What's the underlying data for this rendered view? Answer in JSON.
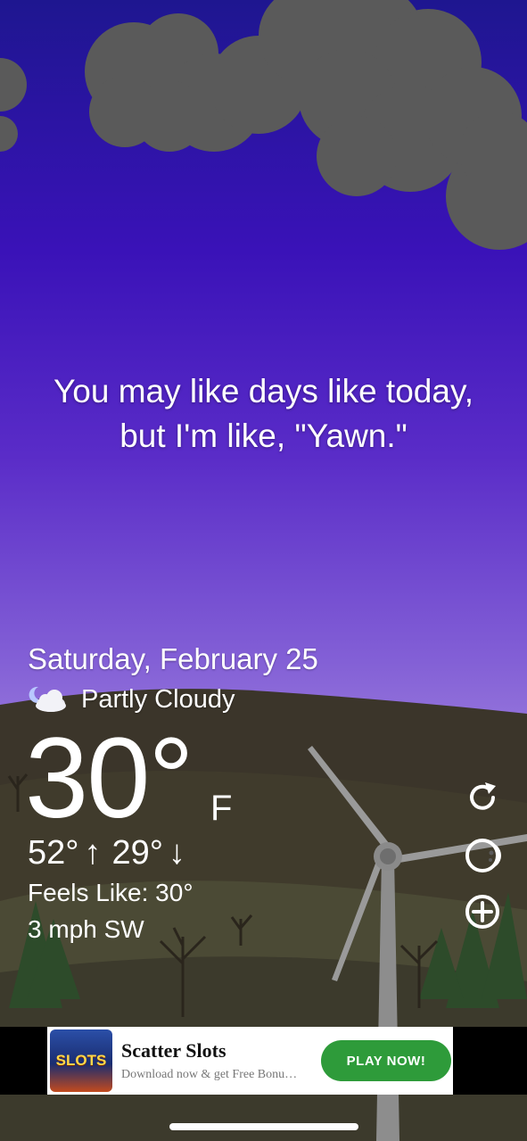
{
  "quote": {
    "line1": "You may like days like today,",
    "line2": "but I'm like, \"Yawn.\""
  },
  "weather": {
    "date": "Saturday, February 25",
    "condition": "Partly Cloudy",
    "condition_icon": "partly-cloudy-night-icon",
    "temperature": "30°",
    "unit": "F",
    "high": "52°",
    "high_arrow": "↑",
    "low": "29°",
    "low_arrow": "↓",
    "feels_like": "Feels Like: 30°",
    "wind": "3 mph SW"
  },
  "side_actions": [
    {
      "icon": "refresh-icon"
    },
    {
      "icon": "theme-icon"
    },
    {
      "icon": "add-icon"
    }
  ],
  "ad": {
    "logo_text": "SLOTS",
    "title": "Scatter Slots",
    "subtitle": "Download now & get Free Bonu…",
    "cta": "PLAY NOW!"
  },
  "colors": {
    "sky_top": "#1e1690",
    "sky_bottom": "#b89ee6",
    "ground": "#3a3328",
    "cta_green": "#2e9b3a"
  }
}
